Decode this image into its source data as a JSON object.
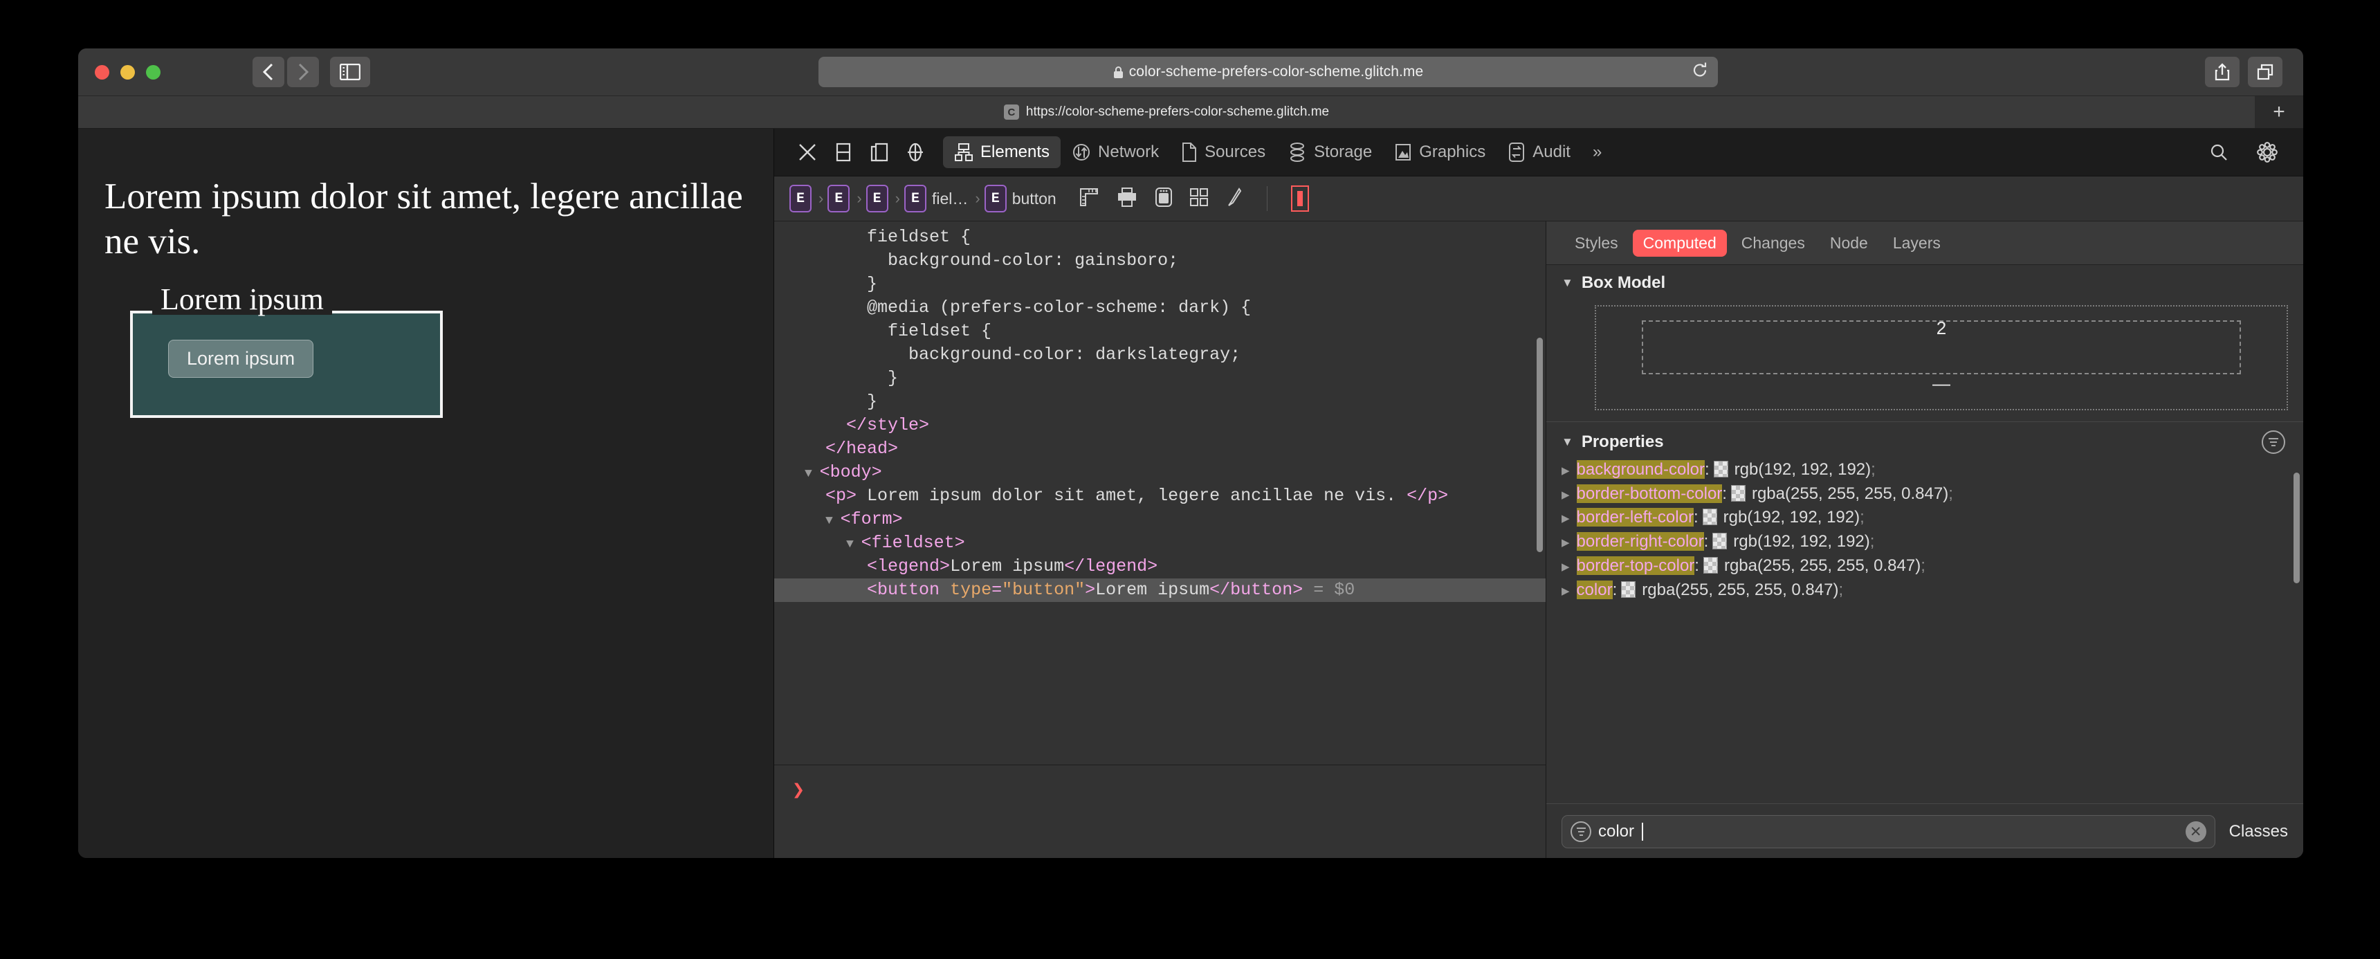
{
  "browser": {
    "url_display": "color-scheme-prefers-color-scheme.glitch.me",
    "lock_icon": "lock-icon",
    "reload_icon": "reload-icon",
    "back_icon": "chevron-left-icon",
    "forward_icon": "chevron-right-icon",
    "sidebar_icon": "sidebar-toggle-icon",
    "share_icon": "share-icon",
    "tab_overview_icon": "tab-overview-icon",
    "new_tab_label": "+",
    "tab": {
      "favicon_letter": "C",
      "title": "https://color-scheme-prefers-color-scheme.glitch.me"
    }
  },
  "page": {
    "paragraph": "Lorem ipsum dolor sit amet, legere ancillae ne vis.",
    "legend": "Lorem ipsum",
    "button_label": "Lorem ipsum",
    "fieldset_bg": "#2f4f4f",
    "page_bg": "#222222"
  },
  "devtools": {
    "toolbar_icons": [
      {
        "name": "close-icon",
        "label": "X"
      },
      {
        "name": "dock-bottom-icon",
        "label": ""
      },
      {
        "name": "dock-side-icon",
        "label": ""
      },
      {
        "name": "inspect-element-icon",
        "label": ""
      }
    ],
    "tabs": [
      {
        "label": "Elements",
        "icon": "elements-icon",
        "active": true
      },
      {
        "label": "Network",
        "icon": "network-icon",
        "active": false
      },
      {
        "label": "Sources",
        "icon": "sources-icon",
        "active": false
      },
      {
        "label": "Storage",
        "icon": "storage-icon",
        "active": false
      },
      {
        "label": "Graphics",
        "icon": "graphics-icon",
        "active": false
      },
      {
        "label": "Audit",
        "icon": "audit-icon",
        "active": false
      }
    ],
    "overflow_label": "»",
    "search_icon": "search-icon",
    "settings_icon": "gear-icon",
    "breadcrumb": [
      {
        "badge": "E",
        "label": ""
      },
      {
        "badge": "E",
        "label": ""
      },
      {
        "badge": "E",
        "label": ""
      },
      {
        "badge": "E",
        "label": "fiel…"
      },
      {
        "badge": "E",
        "label": "button"
      }
    ],
    "breadcrumb_icons": [
      {
        "name": "ruler-icon"
      },
      {
        "name": "print-icon"
      },
      {
        "name": "device-icon"
      },
      {
        "name": "grid-icon"
      },
      {
        "name": "paintbrush-icon"
      },
      {
        "name": "box-model-icon"
      }
    ],
    "dom_lines": [
      {
        "indent": 4,
        "parts": [
          {
            "t": "txt",
            "v": "fieldset {"
          }
        ]
      },
      {
        "indent": 5,
        "parts": [
          {
            "t": "txt",
            "v": "background-color: gainsboro;"
          }
        ]
      },
      {
        "indent": 4,
        "parts": [
          {
            "t": "txt",
            "v": "}"
          }
        ]
      },
      {
        "indent": 4,
        "parts": [
          {
            "t": "txt",
            "v": "@media (prefers-color-scheme: dark) {"
          }
        ]
      },
      {
        "indent": 5,
        "parts": [
          {
            "t": "txt",
            "v": "fieldset {"
          }
        ]
      },
      {
        "indent": 6,
        "parts": [
          {
            "t": "txt",
            "v": "background-color: darkslategray;"
          }
        ]
      },
      {
        "indent": 5,
        "parts": [
          {
            "t": "txt",
            "v": "}"
          }
        ]
      },
      {
        "indent": 4,
        "parts": [
          {
            "t": "txt",
            "v": "}"
          }
        ]
      },
      {
        "indent": 3,
        "parts": [
          {
            "t": "tag",
            "v": "</style>"
          }
        ]
      },
      {
        "indent": 2,
        "parts": [
          {
            "t": "tag",
            "v": "</head>"
          }
        ]
      },
      {
        "indent": 1,
        "tri": true,
        "parts": [
          {
            "t": "tag",
            "v": "<body>"
          }
        ]
      },
      {
        "indent": 2,
        "parts": [
          {
            "t": "tag",
            "v": "<p>"
          },
          {
            "t": "txt",
            "v": " Lorem ipsum dolor sit amet, legere ancillae ne vis. "
          },
          {
            "t": "tag",
            "v": "</p>"
          }
        ]
      },
      {
        "indent": 2,
        "tri": true,
        "parts": [
          {
            "t": "tag",
            "v": "<form>"
          }
        ]
      },
      {
        "indent": 3,
        "tri": true,
        "parts": [
          {
            "t": "tag",
            "v": "<fieldset>"
          }
        ]
      },
      {
        "indent": 4,
        "parts": [
          {
            "t": "tag",
            "v": "<legend>"
          },
          {
            "t": "txt",
            "v": "Lorem ipsum"
          },
          {
            "t": "tag",
            "v": "</legend>"
          }
        ]
      },
      {
        "indent": 4,
        "selected": true,
        "parts": [
          {
            "t": "tag",
            "v": "<button "
          },
          {
            "t": "attrn",
            "v": "type"
          },
          {
            "t": "tag",
            "v": "="
          },
          {
            "t": "attrv",
            "v": "\"button\""
          },
          {
            "t": "tag",
            "v": ">"
          },
          {
            "t": "txt",
            "v": "Lorem ipsum"
          },
          {
            "t": "tag",
            "v": "</button>"
          },
          {
            "t": "dollar",
            "v": " = $0"
          }
        ]
      }
    ],
    "console_prompt": "❯",
    "sidebar": {
      "tabs": [
        {
          "label": "Styles",
          "active": false
        },
        {
          "label": "Computed",
          "active": true
        },
        {
          "label": "Changes",
          "active": false
        },
        {
          "label": "Node",
          "active": false
        },
        {
          "label": "Layers",
          "active": false
        }
      ],
      "box_model": {
        "title": "Box Model",
        "border_value": "2",
        "padding_value": "—"
      },
      "properties_title": "Properties",
      "properties": [
        {
          "name": "background-color",
          "swatch": true,
          "value": "rgb(192, 192, 192)"
        },
        {
          "name": "border-bottom-color",
          "swatch": true,
          "value": "rgba(255, 255, 255, 0.847)"
        },
        {
          "name": "border-left-color",
          "swatch": true,
          "value": "rgb(192, 192, 192)"
        },
        {
          "name": "border-right-color",
          "swatch": true,
          "value": "rgb(192, 192, 192)"
        },
        {
          "name": "border-top-color",
          "swatch": true,
          "value": "rgba(255, 255, 255, 0.847)"
        },
        {
          "name": "color",
          "swatch": true,
          "value": "rgba(255, 255, 255, 0.847)"
        }
      ],
      "filter_value": "color",
      "filter_icon": "filter-icon",
      "clear_icon": "clear-icon",
      "classes_label": "Classes"
    },
    "accent_active": "#ff5b5b",
    "highlight_color": "#9a8b28"
  }
}
